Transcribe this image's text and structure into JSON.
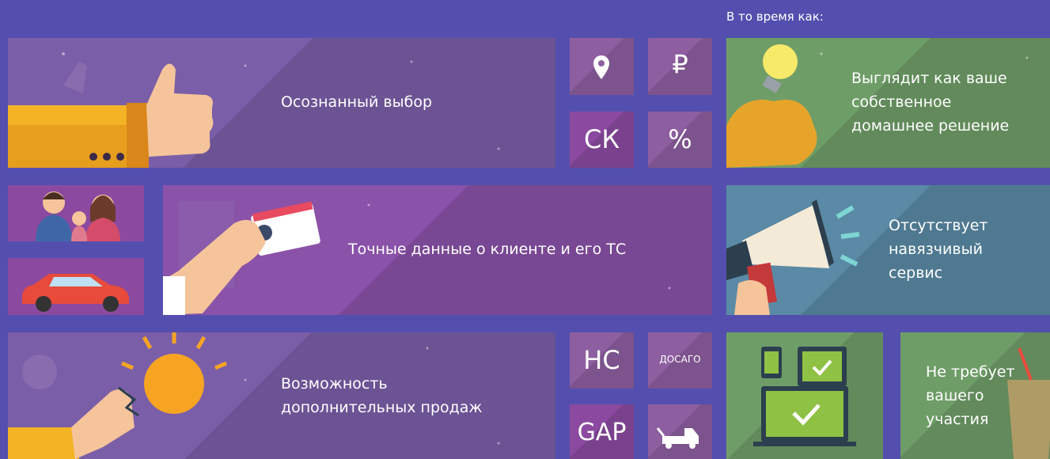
{
  "header": {
    "while_text": "В то время как:"
  },
  "tiles": {
    "conscious_choice": "Осознанный выбор",
    "accurate_data": "Точные данные о клиенте и его ТС",
    "additional_sales": "Возможность дополнительных продаж",
    "homegrown": "Выглядит как ваше собственное домашнее решение",
    "no_intrusive": "Отсутствует навязчивый сервис",
    "no_participation": "Не требует вашего участия"
  },
  "small": {
    "ruble": "₽",
    "sk": "СК",
    "percent": "%",
    "ns": "НС",
    "dosago": "ДОСАГО",
    "gap": "GAP"
  },
  "icons": [
    "location-pin-icon",
    "ruble-icon",
    "thumbs-up-icon",
    "family-icon",
    "car-icon",
    "id-card-hand-icon",
    "lightbulb-hand-icon",
    "tow-truck-icon",
    "lightbulb-brain-icon",
    "megaphone-icon",
    "devices-check-icon",
    "drink-icon"
  ]
}
